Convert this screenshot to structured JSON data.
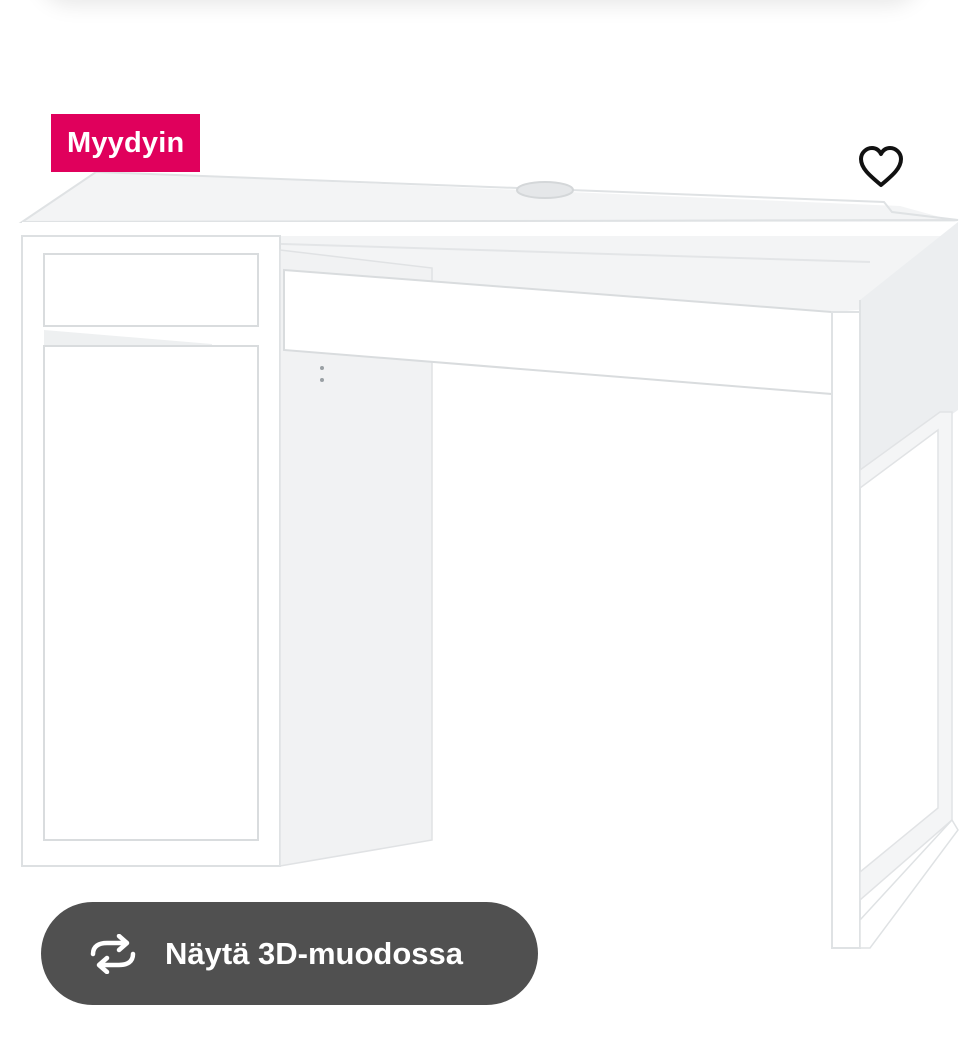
{
  "colors": {
    "badge_bg": "#e0005c",
    "button_bg": "#505050",
    "desk": "#ffffff",
    "desk_shade": "#eef0f1",
    "desk_line": "#d7dadc"
  },
  "badge": {
    "text": "Myydyin"
  },
  "favorite": {
    "icon": "heart-icon"
  },
  "view_3d": {
    "label": "Näytä 3D-muodossa",
    "icon": "rotate-arrows-icon"
  },
  "image": {
    "subject": "desk"
  }
}
